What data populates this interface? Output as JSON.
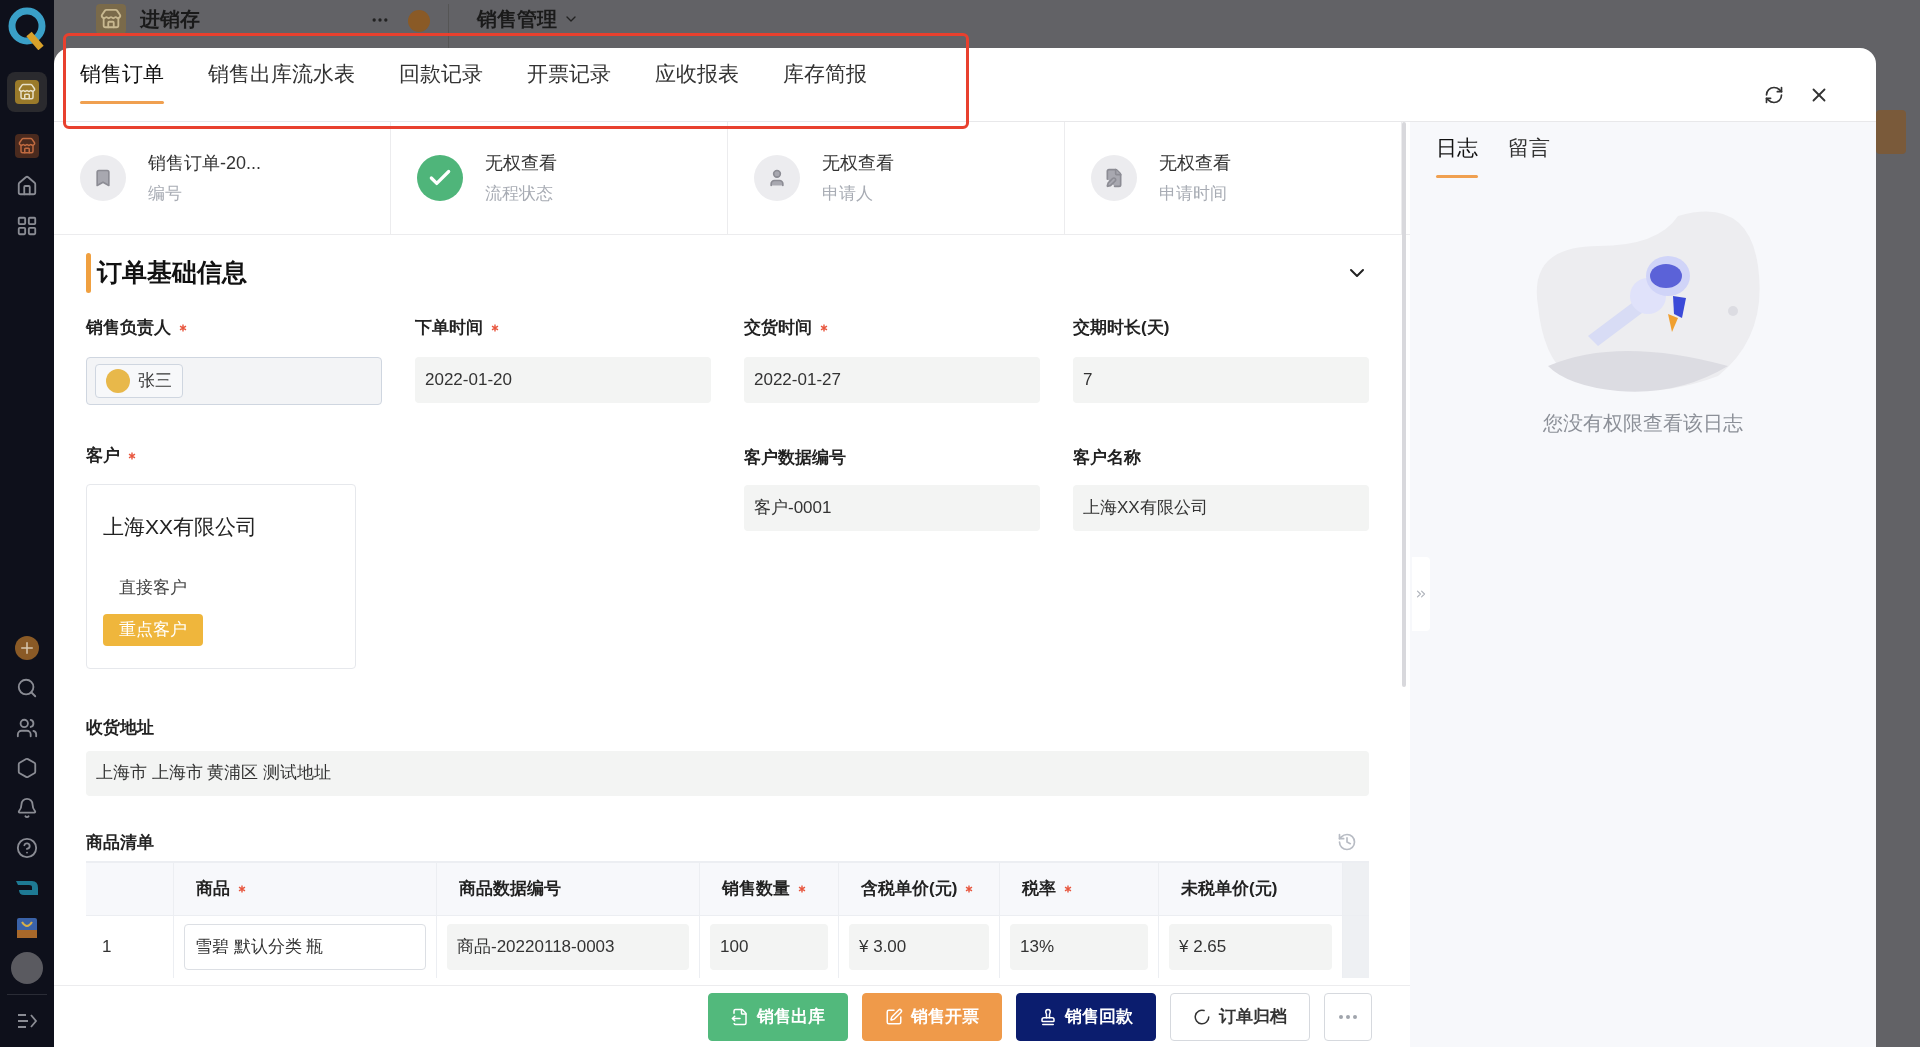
{
  "background": {
    "app_title": "进销存",
    "module_title": "销售管理"
  },
  "modal": {
    "tabs": [
      {
        "label": "销售订单",
        "selected": true
      },
      {
        "label": "销售出库流水表",
        "selected": false
      },
      {
        "label": "回款记录",
        "selected": false
      },
      {
        "label": "开票记录",
        "selected": false
      },
      {
        "label": "应收报表",
        "selected": false
      },
      {
        "label": "库存简报",
        "selected": false
      }
    ],
    "summary": [
      {
        "kind": "doc",
        "value": "销售订单-20...",
        "label": "编号"
      },
      {
        "kind": "check",
        "value": "无权查看",
        "label": "流程状态"
      },
      {
        "kind": "person",
        "value": "无权查看",
        "label": "申请人"
      },
      {
        "kind": "note",
        "value": "无权查看",
        "label": "申请时间"
      }
    ],
    "section": {
      "title": "订单基础信息",
      "expanded": true
    },
    "fields": [
      {
        "label": "销售负责人",
        "required": true,
        "kind": "user",
        "value": "张三"
      },
      {
        "label": "下单时间",
        "required": true,
        "kind": "text",
        "value": "2022-01-20"
      },
      {
        "label": "交货时间",
        "required": true,
        "kind": "text",
        "value": "2022-01-27"
      },
      {
        "label": "交期时长(天)",
        "required": false,
        "kind": "text",
        "value": "7"
      }
    ],
    "customer": {
      "label": "客户",
      "required": true,
      "name": "上海XX有限公司",
      "type": "直接客户",
      "tag": "重点客户"
    },
    "customer_fields": [
      {
        "label": "客户数据编号",
        "value": "客户-0001"
      },
      {
        "label": "客户名称",
        "value": "上海XX有限公司"
      }
    ],
    "address": {
      "label": "收货地址",
      "value": "上海市 上海市 黄浦区 测试地址"
    },
    "goods": {
      "title": "商品清单",
      "columns": [
        {
          "label": "商品",
          "required": true,
          "kind": "input"
        },
        {
          "label": "商品数据编号",
          "required": false,
          "kind": "readonly"
        },
        {
          "label": "销售数量",
          "required": true,
          "kind": "readonly"
        },
        {
          "label": "含税单价(元)",
          "required": true,
          "kind": "readonly"
        },
        {
          "label": "税率",
          "required": true,
          "kind": "readonly"
        },
        {
          "label": "未税单价(元)",
          "required": false,
          "kind": "readonly"
        }
      ],
      "rows": [
        {
          "index": "1",
          "cells": [
            "雪碧 默认分类 瓶",
            "商品-20220118-0003",
            "100",
            "¥ 3.00",
            "13%",
            "¥ 2.65"
          ]
        }
      ]
    },
    "actions": [
      {
        "label": "销售出库",
        "kind": "outbound"
      },
      {
        "label": "销售开票",
        "kind": "invoice"
      },
      {
        "label": "销售回款",
        "kind": "payment"
      },
      {
        "label": "订单归档",
        "kind": "archive"
      }
    ],
    "side": {
      "tabs": [
        {
          "label": "日志",
          "selected": true
        },
        {
          "label": "留言",
          "selected": false
        }
      ],
      "empty_text": "您没有权限查看该日志"
    }
  }
}
